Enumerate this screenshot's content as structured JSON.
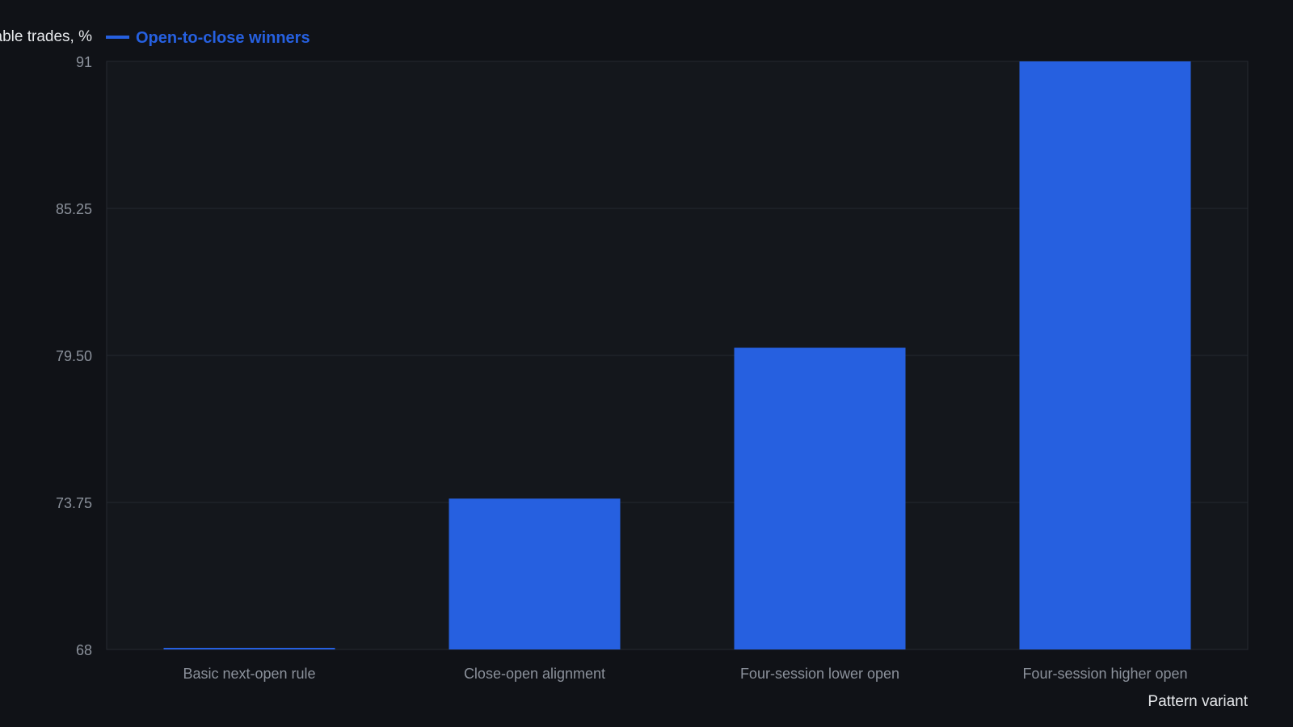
{
  "chart_data": {
    "type": "bar",
    "title": "",
    "ylabel": "Profitable trades, %",
    "xlabel": "Pattern variant",
    "categories": [
      "Basic next-open rule",
      "Close-open alignment",
      "Four-session lower open",
      "Four-session higher open"
    ],
    "series": [
      {
        "name": "Open-to-close winners",
        "values": [
          68,
          73.9,
          79.8,
          91
        ],
        "color": "#2660e0"
      }
    ],
    "ylim": [
      68,
      91
    ],
    "yticks": [
      "68",
      "73.75",
      "79.50",
      "85.25",
      "91"
    ],
    "grid": true,
    "legend_position": "top-left"
  },
  "colors": {
    "background": "#101217",
    "plot_background": "#14171c",
    "grid": "#252931",
    "bar": "#2660e0",
    "tick_text": "#8b919b",
    "axis_title": "#e6e8eb"
  }
}
